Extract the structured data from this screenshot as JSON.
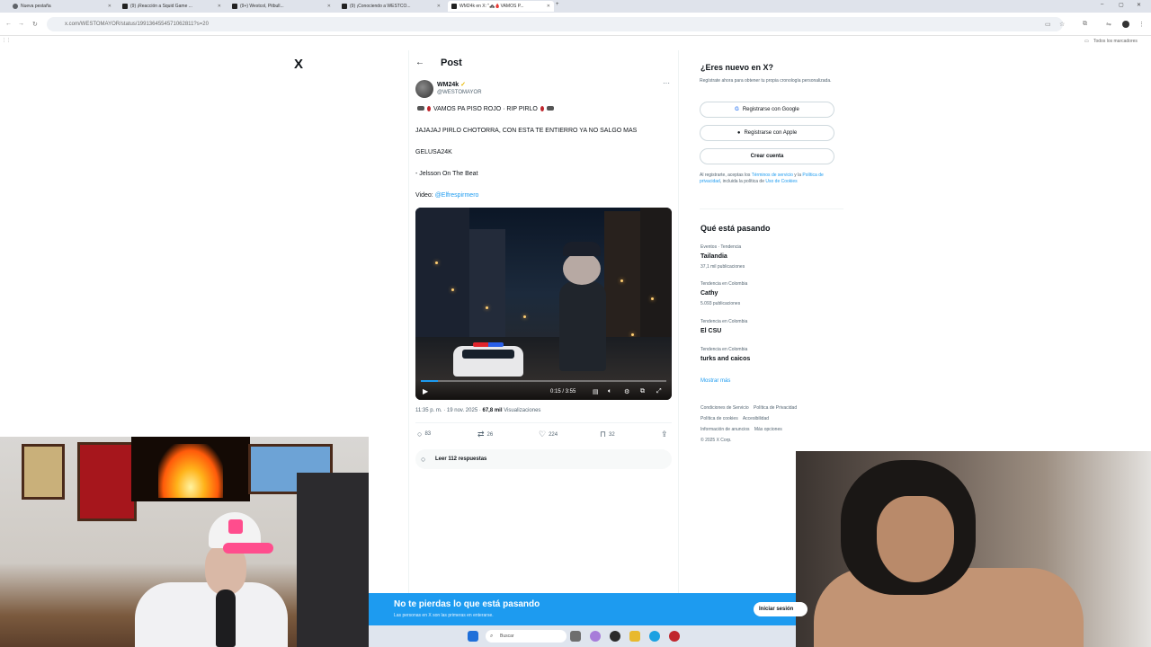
{
  "browser": {
    "tabs": [
      {
        "title": "Nueva pestaña"
      },
      {
        "title": "(9) ¡Reacción a Squid Game ..."
      },
      {
        "title": "(9+) Westcol, Pitbull..."
      },
      {
        "title": "(9) ¡Conociendo a WESTCO..."
      },
      {
        "title": "WM24k en X: \"🚓🩸VAMOS P..."
      }
    ],
    "url": "x.com/WESTOMAYOR/status/1991364554571062811?s=20",
    "bookmarks_label": "Todos los marcadores"
  },
  "post": {
    "header_title": "Post",
    "author_name": "WM24k",
    "author_handle": "@WESTOMAYOR",
    "line1": "VAMOS PA PISO ROJO · RIP PIRLO",
    "line2": "JAJAJAJ PIRLO CHOTORRA, CON ESTA TE ENTIERRO YA NO SALGO MAS",
    "line3": "GELUSA24K",
    "line4": "- Jelsson On The Beat",
    "video_label": "Video:",
    "video_credit": "@Elfrespirmero",
    "video_time": "0:15 / 3:55",
    "video_progress": 0.07,
    "timestamp": "11:35 p. m. · 19 nov. 2025 ·",
    "views_count": "67,8 mil",
    "views_label": "Visualizaciones",
    "stats": {
      "replies": "83",
      "reposts": "26",
      "likes": "224",
      "bookmarks": "32"
    },
    "read_replies": "Leer 112 respuestas"
  },
  "sidebar": {
    "new_title": "¿Eres nuevo en X?",
    "new_sub": "Regístrate ahora para obtener tu propia cronología personalizada.",
    "google_btn": "Registrarse con Google",
    "apple_btn": "Registrarse con Apple",
    "create_btn": "Crear cuenta",
    "terms_pre": "Al registrarte, aceptas los ",
    "terms_link1": "Términos de servicio",
    "terms_mid": " y la ",
    "terms_link2": "Política de privacidad",
    "terms_mid2": ", incluida la política de ",
    "terms_link3": "Uso de Cookies",
    "trending_title": "Qué está pasando",
    "trends": [
      {
        "category": "Eventos · Tendencia",
        "name": "Tailandia",
        "count": "37,1 mil publicaciones"
      },
      {
        "category": "Tendencia en Colombia",
        "name": "Cathy",
        "count": "5.093 publicaciones"
      },
      {
        "category": "Tendencia en Colombia",
        "name": "El CSU",
        "count": ""
      },
      {
        "category": "Tendencia en Colombia",
        "name": "turks and caicos",
        "count": ""
      }
    ],
    "show_more": "Mostrar más",
    "footer": [
      "Condiciones de Servicio",
      "Política de Privacidad",
      "Política de cookies",
      "Accesibilidad",
      "Información de anuncios",
      "Más opciones",
      "© 2025 X Corp."
    ]
  },
  "banner": {
    "title": "No te pierdas lo que está pasando",
    "subtitle": "Las personas en X son las primeras en enterarse.",
    "login_btn": "Iniciar sesión"
  },
  "taskbar": {
    "search_placeholder": "Buscar"
  },
  "colors": {
    "accent": "#1d9bf0",
    "text": "#0f1419",
    "muted": "#536471"
  }
}
